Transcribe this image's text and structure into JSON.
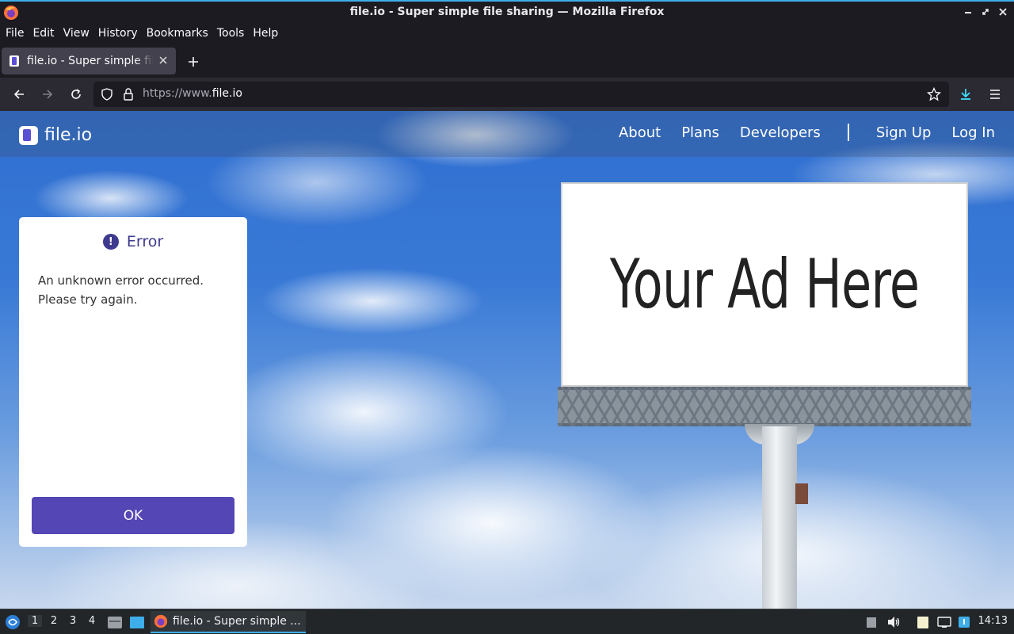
{
  "window": {
    "title": "file.io - Super simple file sharing — Mozilla Firefox"
  },
  "menu": [
    {
      "label": "File"
    },
    {
      "label": "Edit"
    },
    {
      "label": "View"
    },
    {
      "label": "History"
    },
    {
      "label": "Bookmarks"
    },
    {
      "label": "Tools"
    },
    {
      "label": "Help"
    }
  ],
  "tab": {
    "title": "file.io - Super simple file sharing"
  },
  "urlbar": {
    "prefix": "https://www.",
    "domain": "file.io"
  },
  "site": {
    "logo_text": "file.io",
    "nav": {
      "about": "About",
      "plans": "Plans",
      "developers": "Developers",
      "signup": "Sign Up",
      "login": "Log In"
    }
  },
  "dialog": {
    "title": "Error",
    "icon_glyph": "!",
    "message_line1": "An unknown error occurred.",
    "message_line2": "Please try again.",
    "ok_label": "OK"
  },
  "billboard": {
    "text": "Your Ad Here"
  },
  "taskbar": {
    "desktops": [
      "1",
      "2",
      "3",
      "4"
    ],
    "task_label": "file.io - Super simple ...",
    "clock": "14:13"
  },
  "colors": {
    "accent": "#3daee9",
    "brand_purple": "#5546b5",
    "dialog_title": "#3e3a8f"
  }
}
